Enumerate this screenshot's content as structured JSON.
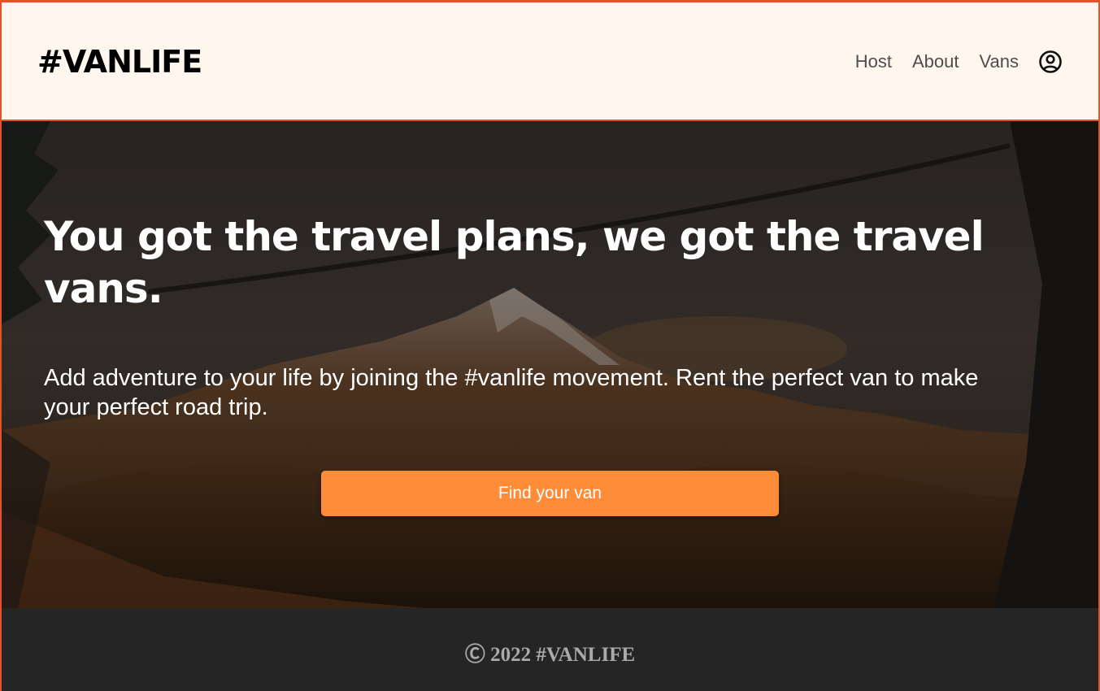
{
  "header": {
    "logo": "#VANLIFE",
    "nav": [
      {
        "label": "Host"
      },
      {
        "label": "About"
      },
      {
        "label": "Vans"
      }
    ],
    "user_icon": "user-circle-icon"
  },
  "hero": {
    "title": "You got the travel plans, we got the travel vans.",
    "text": "Add adventure to your life by joining the #vanlife movement. Rent the perfect van to make your perfect road trip.",
    "cta_label": "Find your van"
  },
  "footer": {
    "text": "Ⓒ 2022 #VANLIFE"
  },
  "colors": {
    "accent": "#ff8c38",
    "header_bg": "#fff7ed",
    "footer_bg": "#252525",
    "frame_border": "#e1542a"
  }
}
